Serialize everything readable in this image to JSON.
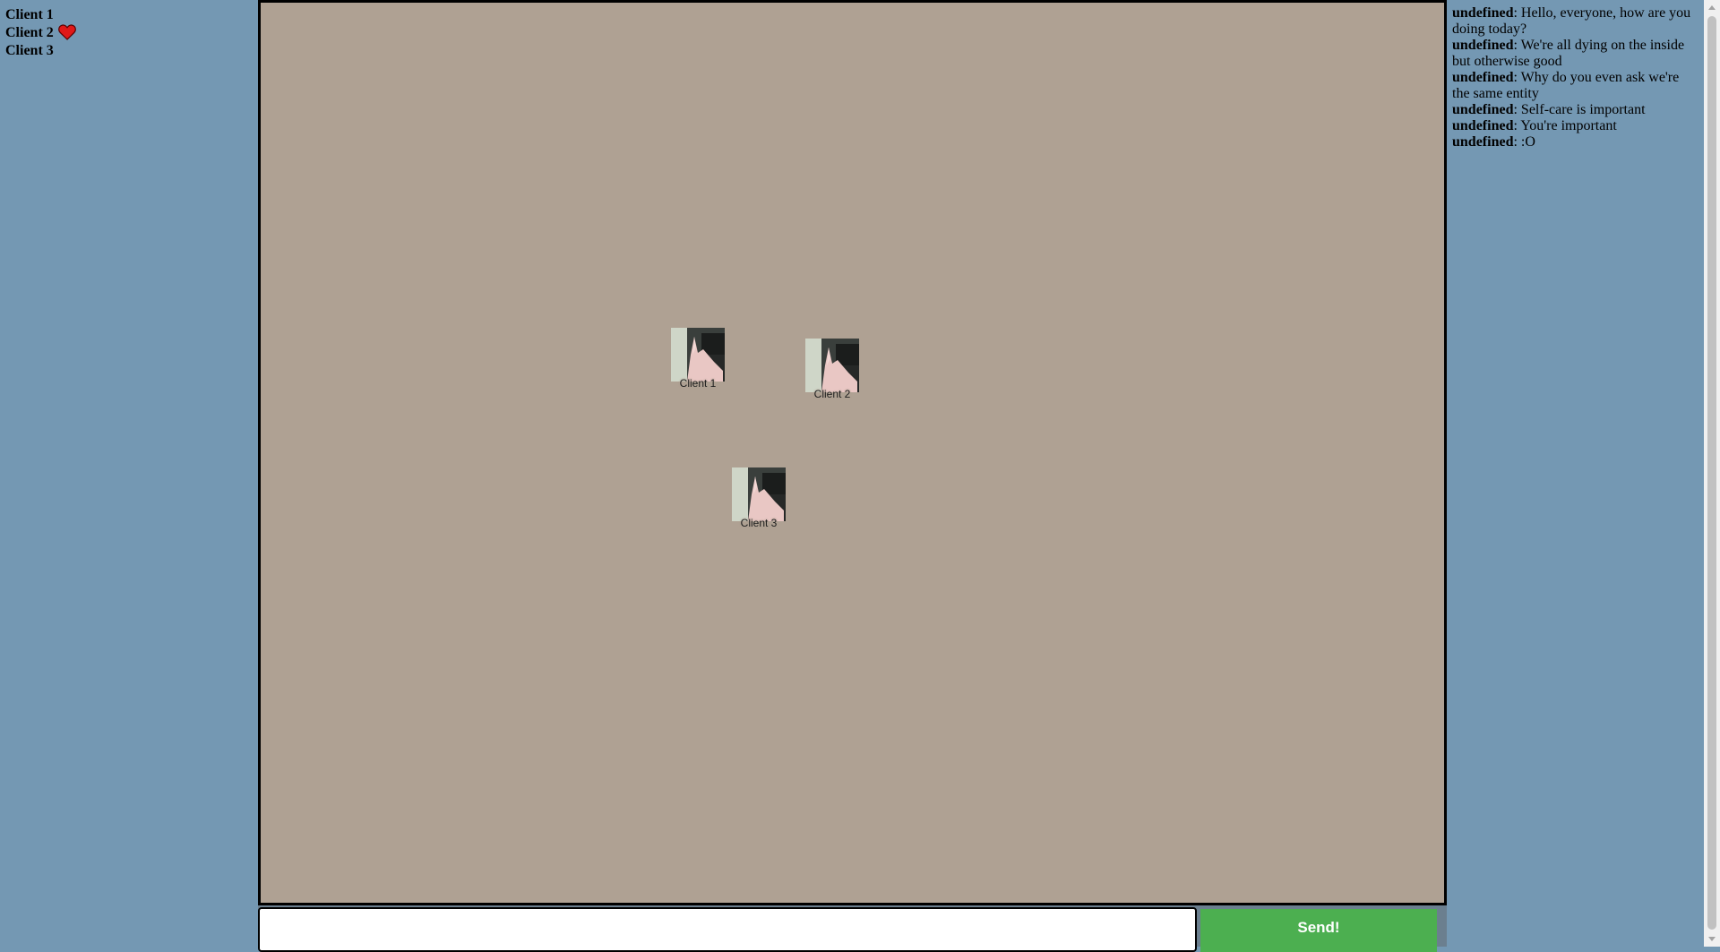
{
  "clients": [
    {
      "name": "Client 1",
      "icon": null
    },
    {
      "name": "Client 2",
      "icon": "heart-icon"
    },
    {
      "name": "Client 3",
      "icon": null
    }
  ],
  "stage": {
    "avatars": [
      {
        "label": "Client 1"
      },
      {
        "label": "Client 2"
      },
      {
        "label": "Client 3"
      }
    ]
  },
  "chat": {
    "messages": [
      {
        "sender": "undefined",
        "text": ": Hello, everyone, how are you doing today?"
      },
      {
        "sender": "undefined",
        "text": ": We're all dying on the inside but otherwise good"
      },
      {
        "sender": "undefined",
        "text": ": Why do you even ask we're the same entity"
      },
      {
        "sender": "undefined",
        "text": ": Self-care is important"
      },
      {
        "sender": "undefined",
        "text": ": You're important"
      },
      {
        "sender": "undefined",
        "text": ": :O"
      }
    ]
  },
  "composer": {
    "input_value": "",
    "input_placeholder": "",
    "send_label": "Send!"
  },
  "colors": {
    "panel": "#7498b3",
    "stage": "#afa193",
    "send": "#4caf50",
    "heart": "#e01818"
  }
}
